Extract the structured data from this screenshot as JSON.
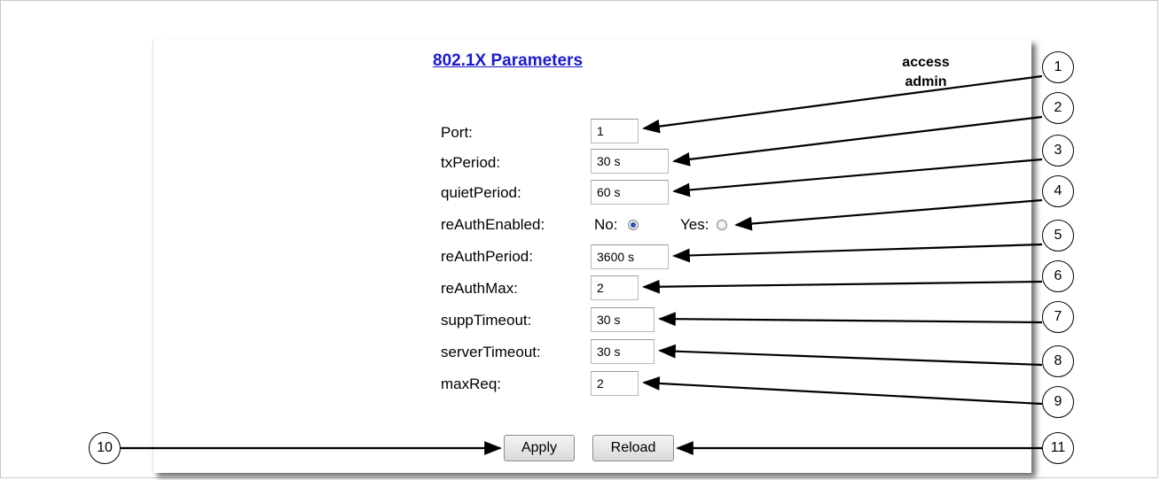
{
  "page": {
    "title": "802.1X Parameters",
    "access_line1": "access",
    "access_line2": "admin"
  },
  "form": {
    "port": {
      "label": "Port:",
      "value": "1"
    },
    "txPeriod": {
      "label": "txPeriod:",
      "value": "30 s"
    },
    "quietPeriod": {
      "label": "quietPeriod:",
      "value": "60 s"
    },
    "reAuthEnabled": {
      "label": "reAuthEnabled:",
      "no_label": "No:",
      "yes_label": "Yes:",
      "selected": "No"
    },
    "reAuthPeriod": {
      "label": "reAuthPeriod:",
      "value": "3600 s"
    },
    "reAuthMax": {
      "label": "reAuthMax:",
      "value": "2"
    },
    "suppTimeout": {
      "label": "suppTimeout:",
      "value": "30 s"
    },
    "serverTimeout": {
      "label": "serverTimeout:",
      "value": "30 s"
    },
    "maxReq": {
      "label": "maxReq:",
      "value": "2"
    }
  },
  "buttons": {
    "apply": "Apply",
    "reload": "Reload"
  },
  "callouts": [
    "1",
    "2",
    "3",
    "4",
    "5",
    "6",
    "7",
    "8",
    "9",
    "10",
    "11"
  ],
  "colors": {
    "title_link": "#1a1ad0",
    "radio_selected": "#2b56b8"
  }
}
